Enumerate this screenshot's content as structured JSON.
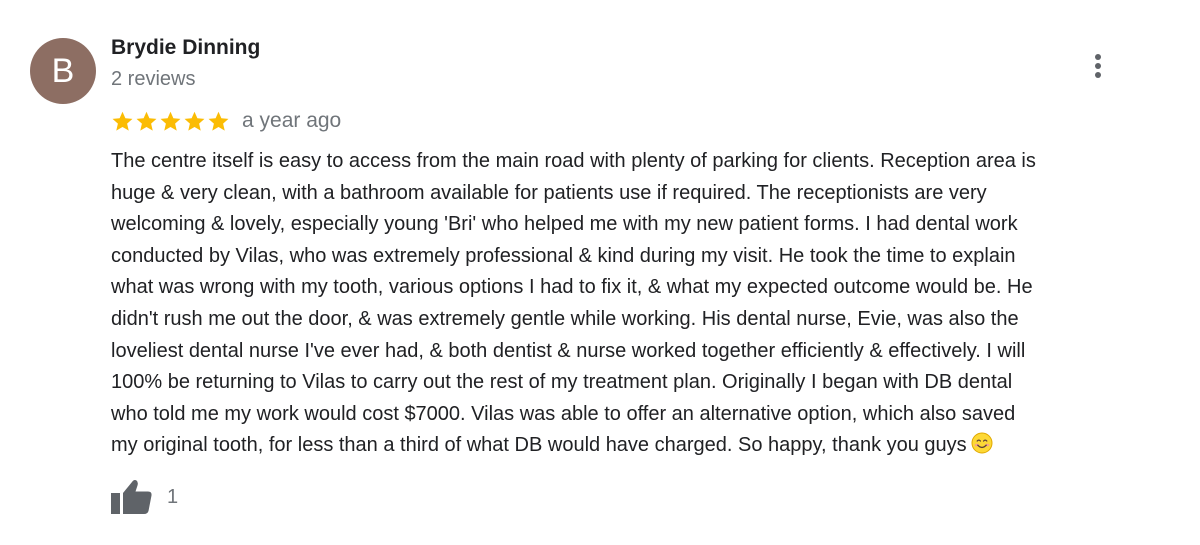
{
  "review": {
    "author_initial": "B",
    "author_name": "Brydie Dinning",
    "review_count": "2 reviews",
    "rating": 5,
    "max_rating": 5,
    "date": "a year ago",
    "text": "The centre itself is easy to access from the main road with plenty of parking for clients. Reception area is\nhuge & very clean, with a bathroom available for patients use if required. The receptionists are very\nwelcoming & lovely, especially young 'Bri' who helped me with my new patient forms. I had dental work\nconducted by Vilas, who was extremely professional & kind during my visit. He took the time to explain\nwhat was wrong with my tooth, various options I had to fix it, & what my expected outcome would be. He\ndidn't rush me out the door, & was extremely gentle while working. His dental nurse, Evie, was also the\nloveliest dental nurse I've ever had, & both dentist & nurse worked together efficiently & effectively. I will\n100% be returning to Vilas to carry out the rest of my treatment plan. Originally I began with DB dental\nwho told me my work would cost $7000. Vilas was able to offer an alternative option, which also saved\nmy original tooth, for less than a third of what DB would have charged. So happy, thank you guys",
    "like_count": "1"
  },
  "icons": {
    "star": "star-icon",
    "more": "more-vertical-icon",
    "like": "thumbs-up-icon",
    "emoji": "smiling-face-emoji"
  },
  "colors": {
    "avatar_bg": "#8d6e63",
    "star": "#fbbc04",
    "name": "#202124",
    "secondary_text": "#70757a",
    "icon": "#5f6368"
  }
}
